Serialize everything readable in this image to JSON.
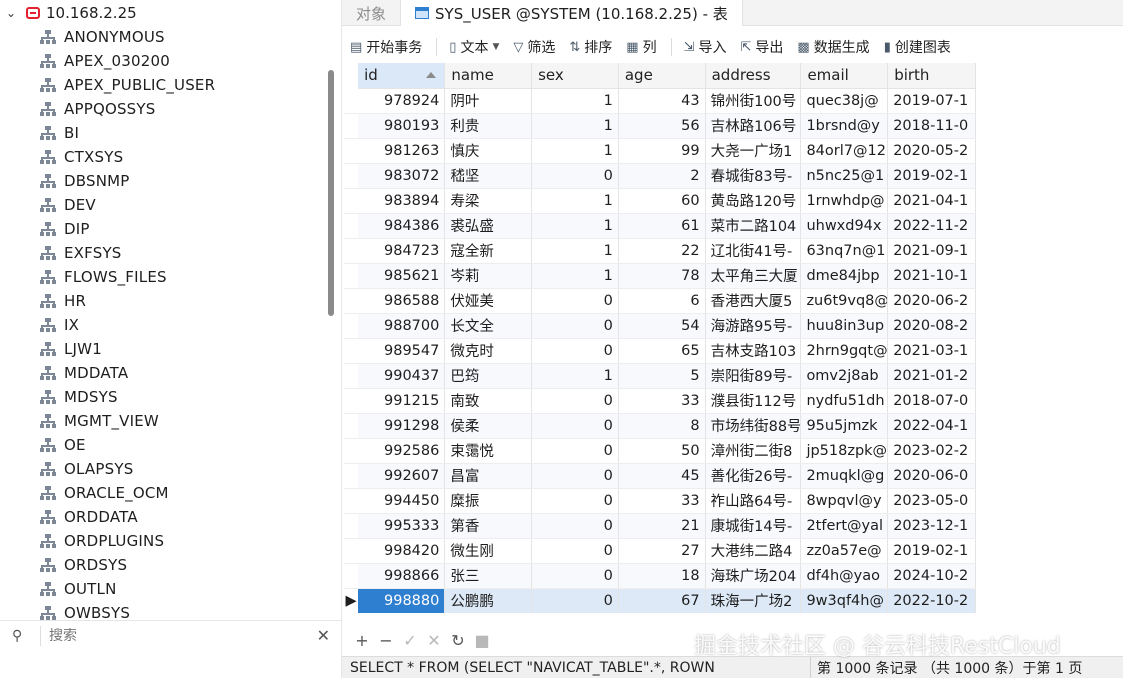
{
  "sidebar": {
    "connection": "10.168.2.25",
    "schemas": [
      "ANONYMOUS",
      "APEX_030200",
      "APEX_PUBLIC_USER",
      "APPQOSSYS",
      "BI",
      "CTXSYS",
      "DBSNMP",
      "DEV",
      "DIP",
      "EXFSYS",
      "FLOWS_FILES",
      "HR",
      "IX",
      "LJW1",
      "MDDATA",
      "MDSYS",
      "MGMT_VIEW",
      "OE",
      "OLAPSYS",
      "ORACLE_OCM",
      "ORDDATA",
      "ORDPLUGINS",
      "ORDSYS",
      "OUTLN",
      "OWBSYS"
    ],
    "search_placeholder": "搜索"
  },
  "tabs": [
    {
      "label": "对象",
      "active": false
    },
    {
      "label": "SYS_USER @SYSTEM (10.168.2.25) - 表",
      "active": true
    }
  ],
  "toolbar": {
    "begin_tx": "开始事务",
    "text": "文本",
    "filter": "筛选",
    "sort": "排序",
    "columns": "列",
    "import": "导入",
    "export": "导出",
    "data_gen": "数据生成",
    "create_chart": "创建图表"
  },
  "grid": {
    "columns": [
      "id",
      "name",
      "sex",
      "age",
      "address",
      "email",
      "birth"
    ],
    "rows": [
      [
        "978924",
        "阴叶",
        "1",
        "43",
        "锦州街100号",
        "quec38j@",
        "2019-07-1"
      ],
      [
        "980193",
        "利贵",
        "1",
        "56",
        "吉林路106号",
        "1brsnd@y",
        "2018-11-0"
      ],
      [
        "981263",
        "慎庆",
        "1",
        "99",
        "大尧一广场1",
        "84orl7@12",
        "2020-05-2"
      ],
      [
        "983072",
        "嵇坚",
        "0",
        "2",
        "春城街83号-",
        "n5nc25@1",
        "2019-02-1"
      ],
      [
        "983894",
        "寿梁",
        "1",
        "60",
        "黄岛路120号",
        "1rnwhdp@",
        "2021-04-1"
      ],
      [
        "984386",
        "裘弘盛",
        "1",
        "61",
        "菜市二路104",
        "uhwxd94x",
        "2022-11-2"
      ],
      [
        "984723",
        "寇全新",
        "1",
        "22",
        "辽北街41号-",
        "63nq7n@1",
        "2021-09-1"
      ],
      [
        "985621",
        "岑莉",
        "1",
        "78",
        "太平角三大厦",
        "dme84jbp",
        "2021-10-1"
      ],
      [
        "986588",
        "伏娅美",
        "0",
        "6",
        "香港西大厦5",
        "zu6t9vq8@",
        "2020-06-2"
      ],
      [
        "988700",
        "长文全",
        "0",
        "54",
        "海游路95号-",
        "huu8in3up",
        "2020-08-2"
      ],
      [
        "989547",
        "微克时",
        "0",
        "65",
        "吉林支路103",
        "2hrn9gqt@",
        "2021-03-1"
      ],
      [
        "990437",
        "巴筠",
        "1",
        "5",
        "崇阳街89号-",
        "omv2j8ab",
        "2021-01-2"
      ],
      [
        "991215",
        "南致",
        "0",
        "33",
        "濮县街112号",
        "nydfu51dh",
        "2018-07-0"
      ],
      [
        "991298",
        "侯柔",
        "0",
        "8",
        "市场纬街88号",
        "95u5jmzk",
        "2022-04-1"
      ],
      [
        "992586",
        "束霭悦",
        "0",
        "50",
        "漳州街二街8",
        "jp518zpk@",
        "2023-02-2"
      ],
      [
        "992607",
        "昌富",
        "0",
        "45",
        "善化街26号-",
        "2muqkl@g",
        "2020-06-0"
      ],
      [
        "994450",
        "糜振",
        "0",
        "33",
        "祚山路64号-",
        "8wpqvl@y",
        "2023-05-0"
      ],
      [
        "995333",
        "第香",
        "0",
        "21",
        "康城街14号-",
        "2tfert@yal",
        "2023-12-1"
      ],
      [
        "998420",
        "微生刚",
        "0",
        "27",
        "大港纬二路4",
        "zz0a57e@",
        "2019-02-1"
      ],
      [
        "998866",
        "张三",
        "0",
        "18",
        "海珠广场204",
        "df4h@yao",
        "2024-10-2"
      ],
      [
        "998880",
        "公鹏鹏",
        "0",
        "67",
        "珠海一广场2",
        "9w3qf4h@",
        "2022-10-2"
      ]
    ],
    "selected_row": 20
  },
  "status": {
    "sql": "SELECT * FROM (SELECT \"NAVICAT_TABLE\".*, ROWN",
    "records": "第 1000 条记录 （共 1000 条）于第 1 页"
  },
  "watermark": "掘金技术社区 @ 谷云科技RestCloud"
}
